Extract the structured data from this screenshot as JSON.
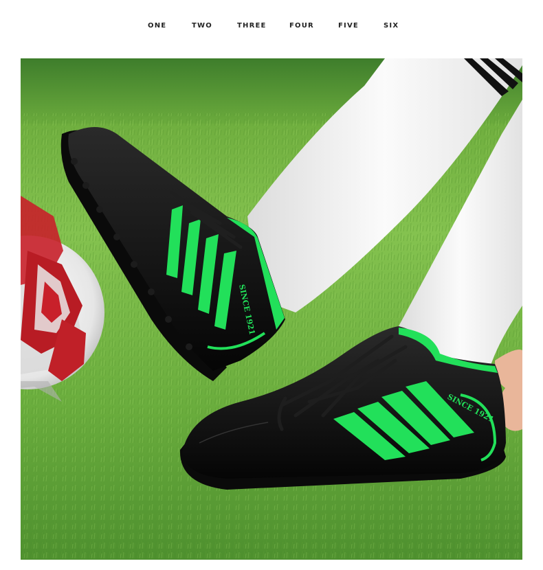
{
  "nav": {
    "tabs": [
      {
        "label": "ONE"
      },
      {
        "label": "TWO"
      },
      {
        "label": "THREE"
      },
      {
        "label": "FOUR"
      },
      {
        "label": "FIVE"
      },
      {
        "label": "SIX"
      }
    ]
  },
  "product_image": {
    "front_shoe_text": "SINCE 1921",
    "back_shoe_text": "SINCE 1921",
    "colors": {
      "grass_light": "#7fbf4c",
      "grass_dark": "#3f7f2a",
      "shoe_black": "#141414",
      "stripe_green": "#22e05a",
      "sock_white": "#f4f4f4",
      "ball_red": "#c8202a"
    }
  }
}
